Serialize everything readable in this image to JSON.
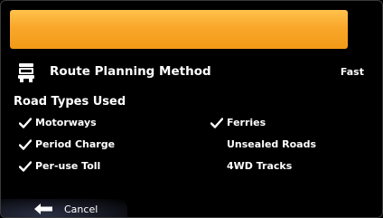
{
  "header": {
    "bar_color": "#f7a21f"
  },
  "route": {
    "icon": "truck-icon",
    "label": "Route Planning Method",
    "value": "Fast"
  },
  "road_types": {
    "title": "Road Types Used",
    "items": [
      {
        "label": "Motorways",
        "checked": true
      },
      {
        "label": "Ferries",
        "checked": true
      },
      {
        "label": "Period Charge",
        "checked": true
      },
      {
        "label": "Unsealed Roads",
        "checked": false
      },
      {
        "label": "Per-use Toll",
        "checked": true
      },
      {
        "label": "4WD Tracks",
        "checked": false
      }
    ]
  },
  "footer": {
    "cancel_label": "Cancel",
    "cancel_icon": "back-arrow-icon"
  }
}
